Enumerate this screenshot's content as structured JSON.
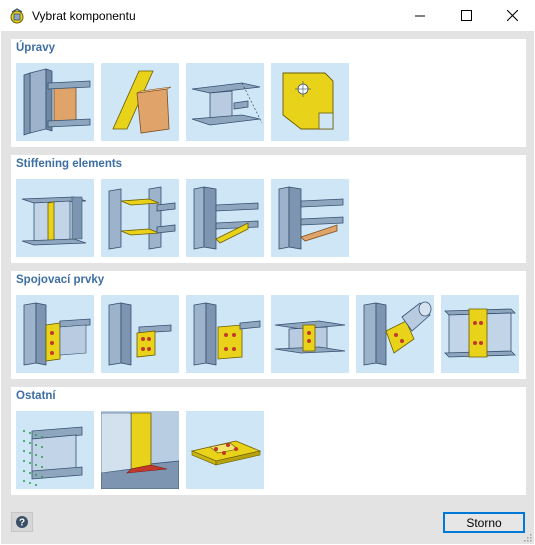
{
  "window": {
    "title": "Vybrat komponentu",
    "icons": {
      "app": "component-app-icon",
      "minimize": "minimize-icon",
      "maximize": "maximize-icon",
      "close": "close-icon"
    }
  },
  "sections": [
    {
      "title": "Úpravy",
      "items": [
        {
          "name": "component-tile-plate-cut",
          "icon": "column-beam-plate-cut-icon"
        },
        {
          "name": "component-tile-cutting-plane",
          "icon": "cutting-plane-icon"
        },
        {
          "name": "component-tile-member-cut",
          "icon": "member-cut-icon"
        },
        {
          "name": "component-tile-plate-editor",
          "icon": "plate-editor-icon"
        }
      ]
    },
    {
      "title": "Stiffening elements",
      "items": [
        {
          "name": "component-tile-web-stiffener",
          "icon": "web-stiffener-icon"
        },
        {
          "name": "component-tile-flange-stiffener",
          "icon": "flange-stiffener-icon"
        },
        {
          "name": "component-tile-diagonal-stiffener",
          "icon": "diagonal-stiffener-icon"
        },
        {
          "name": "component-tile-haunch",
          "icon": "haunch-icon"
        }
      ]
    },
    {
      "title": "Spojovací prvky",
      "items": [
        {
          "name": "component-tile-fin-plate",
          "icon": "fin-plate-icon"
        },
        {
          "name": "component-tile-angle-cleat",
          "icon": "angle-cleat-icon"
        },
        {
          "name": "component-tile-end-plate",
          "icon": "end-plate-icon"
        },
        {
          "name": "component-tile-splice",
          "icon": "splice-plate-icon"
        },
        {
          "name": "component-tile-tube-connection",
          "icon": "tube-gusset-icon"
        },
        {
          "name": "component-tile-cover-plate",
          "icon": "cover-plate-icon"
        }
      ]
    },
    {
      "title": "Ostatní",
      "items": [
        {
          "name": "component-tile-auxiliary-plane",
          "icon": "auxiliary-plane-icon"
        },
        {
          "name": "component-tile-weld",
          "icon": "weld-icon"
        },
        {
          "name": "component-tile-base-plate",
          "icon": "base-plate-icon"
        }
      ]
    }
  ],
  "footer": {
    "help_icon": "help-icon",
    "cancel_label": "Storno"
  },
  "colors": {
    "title_blue": "#3d6fa3",
    "tile_bg": "#cfe6f7",
    "plate_yellow": "#e8d21a",
    "steel": "#8fa6bf",
    "accent": "#0078d7"
  }
}
